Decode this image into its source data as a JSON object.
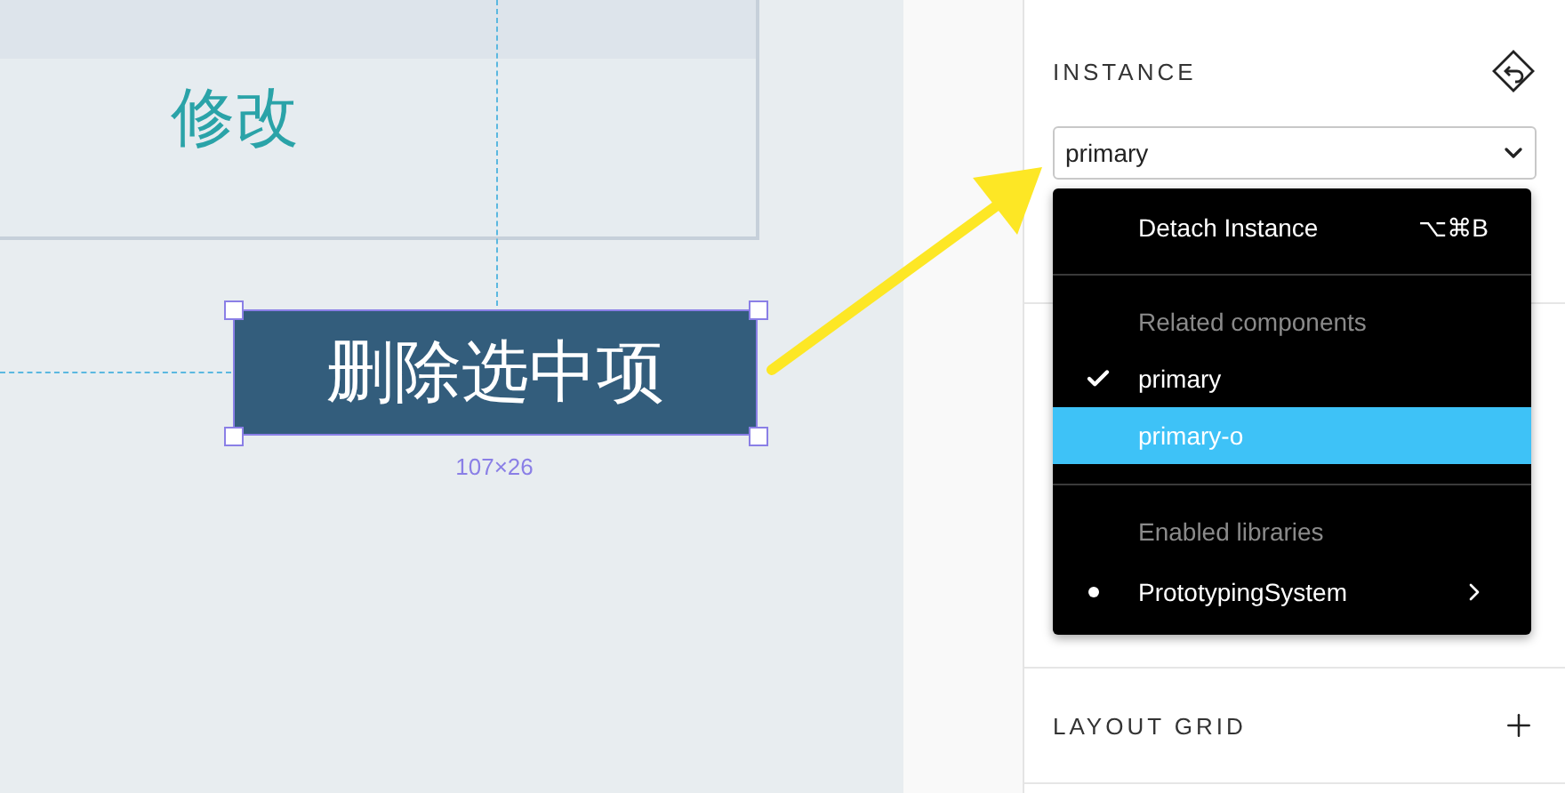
{
  "canvas": {
    "frame": {
      "label": "修改"
    },
    "selected_button": {
      "label": "删除选中项",
      "dimensions": "107×26"
    }
  },
  "panel": {
    "sections": [
      {
        "kind": "instance",
        "title": "INSTANCE",
        "dropdown": {
          "value": "primary",
          "open": true
        }
      },
      {
        "kind": "empty"
      },
      {
        "kind": "layout_grid",
        "title": "LAYOUT GRID"
      }
    ]
  },
  "menu": {
    "items": [
      {
        "kind": "action",
        "label": "Detach Instance",
        "shortcut": "⌥⌘B"
      },
      {
        "kind": "divider"
      },
      {
        "kind": "header",
        "label": "Related components"
      },
      {
        "kind": "option",
        "label": "primary",
        "checked": true,
        "selected": false
      },
      {
        "kind": "option",
        "label": "primary-o",
        "checked": false,
        "selected": true
      },
      {
        "kind": "divider"
      },
      {
        "kind": "header",
        "label": "Enabled libraries"
      },
      {
        "kind": "library",
        "label": "PrototypingSystem",
        "active": true
      }
    ]
  }
}
